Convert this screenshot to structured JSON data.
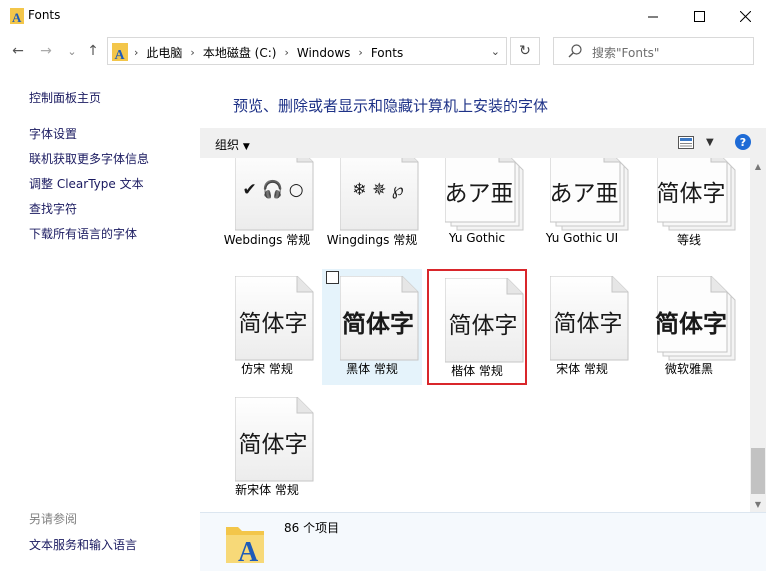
{
  "window": {
    "title": "Fonts",
    "minimize_glyph": "—",
    "maximize_glyph": "☐",
    "close_glyph": "✕"
  },
  "nav": {
    "back_glyph": "←",
    "forward_glyph": "→",
    "recent_glyph": "⌄",
    "up_glyph": "↑",
    "breadcrumbs": [
      "此电脑",
      "本地磁盘 (C:)",
      "Windows",
      "Fonts"
    ],
    "search_placeholder": "搜索\"Fonts\""
  },
  "sidebar": {
    "home": "控制面板主页",
    "links": [
      "字体设置",
      "联机获取更多字体信息",
      "调整 ClearType 文本",
      "查找字符",
      "下载所有语言的字体"
    ],
    "see_also_title": "另请参阅",
    "see_also_links": [
      "文本服务和输入语言"
    ]
  },
  "main": {
    "heading": "预览、删除或者显示和隐藏计算机上安装的字体",
    "organize_label": "组织",
    "help_label": "?"
  },
  "fonts": [
    {
      "label": "Webdings 常规",
      "preview": "✔ 🎧 ○",
      "stacked": false
    },
    {
      "label": "Wingdings 常规",
      "preview": "❄ ✵ ℘",
      "stacked": false
    },
    {
      "label": "Yu Gothic",
      "preview": "あア亜",
      "stacked": true
    },
    {
      "label": "Yu Gothic UI",
      "preview": "あア亜",
      "stacked": true
    },
    {
      "label": "等线",
      "preview": "简体字",
      "stacked": true
    },
    {
      "label": "仿宋 常规",
      "preview": "简体字",
      "stacked": false
    },
    {
      "label": "黑体 常规",
      "preview": "简体字",
      "stacked": false,
      "hovered": true
    },
    {
      "label": "楷体 常规",
      "preview": "简体字",
      "stacked": false,
      "selected": true
    },
    {
      "label": "宋体 常规",
      "preview": "简体字",
      "stacked": false
    },
    {
      "label": "微软雅黑",
      "preview": "简体字",
      "stacked": true
    },
    {
      "label": "新宋体 常规",
      "preview": "简体字",
      "stacked": false
    }
  ],
  "status": {
    "count": "86 个项目"
  },
  "colors": {
    "link": "#1a1a60",
    "heading": "#1e3287",
    "selection_border": "#d9262b",
    "hover_bg": "#e5f3fb"
  }
}
